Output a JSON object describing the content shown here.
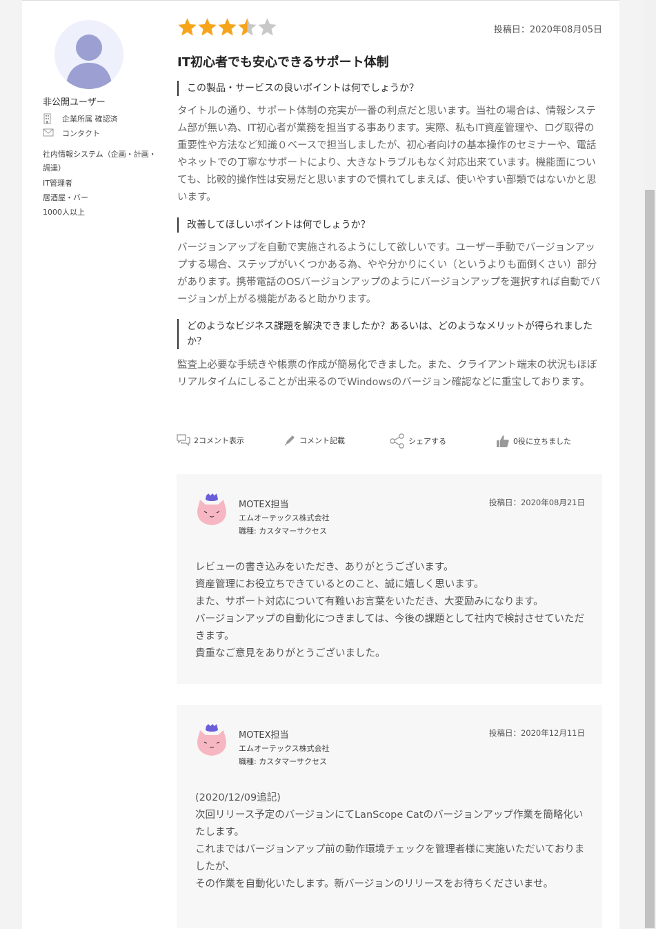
{
  "review": {
    "rating": 3.5,
    "rating_max": 5,
    "date": "投稿日：2020年08月05日",
    "title": "IT初心者でも安心できるサポート体制"
  },
  "user": {
    "name": "非公開ユーザー",
    "company_verified": "企業所属 確認済",
    "contact": "コンタクト",
    "department": "社内情報システム（企画・計画・調達）",
    "position": "IT管理者",
    "industry": "居酒屋・バー",
    "company_size": "1000人以上"
  },
  "questions": [
    {
      "heading": "この製品・サービスの良いポイントは何でしょうか？",
      "answer": "タイトルの通り、サポート体制の充実が一番の利点だと思います。当社の場合は、情報システム部が無い為、IT初心者が業務を担当する事あります。実際、私もIT資産管理や、ログ取得の重要性や方法など知識０ベースで担当しましたが、初心者向けの基本操作のセミナーや、電話やネットでの丁寧なサポートにより、大きなトラブルもなく対応出来ています。機能面についても、比較的操作性は安易だと思いますので慣れてしまえば、使いやすい部類ではないかと思います。"
    },
    {
      "heading": "改善してほしいポイントは何でしょうか？",
      "answer": "バージョンアップを自動で実施されるようにして欲しいです。ユーザー手動でバージョンアップする場合、ステップがいくつかある為、やや分かりにくい（というよりも面倒くさい）部分があります。携帯電話のOSバージョンアップのようにバージョンアップを選択すれば自動でバージョンが上がる機能があると助かります。"
    },
    {
      "heading": "どのようなビジネス課題を解決できましたか？あるいは、どのようなメリットが得られましたか？",
      "answer": "監査上必要な手続きや帳票の作成が簡易化できました。また、クライアント端末の状況もほぼリアルタイムにしることが出来るのでWindowsのバージョン確認などに重宝しております。"
    }
  ],
  "actions": {
    "comments": "2コメント表示",
    "write_comment": "コメント記載",
    "share": "シェアする",
    "helpful": "0役に立ちました"
  },
  "replies": [
    {
      "name": "MOTEX担当",
      "company": "エムオーテックス株式会社",
      "role": "職種: カスタマーサクセス",
      "date": "投稿日：2020年08月21日",
      "text": "レビューの書き込みをいただき、ありがとうございます。\n資産管理にお役立ちできているとのこと、誠に嬉しく思います。\nまた、サポート対応について有難いお言葉をいただき、大変励みになります。\nバージョンアップの自動化につきましては、今後の課題として社内で検討させていただきます。\n貴重なご意見をありがとうございました。"
    },
    {
      "name": "MOTEX担当",
      "company": "エムオーテックス株式会社",
      "role": "職種: カスタマーサクセス",
      "date": "投稿日：2020年12月11日",
      "text": "(2020/12/09追記)\n次回リリース予定のバージョンにてLanScope Catのバージョンアップ作業を簡略化いたします。\nこれまではバージョンアップ前の動作環境チェックを管理者様に実施いただいておりましたが、\nその作業を自動化いたします。新バージョンのリリースをお待ちくださいませ。"
    }
  ],
  "colors": {
    "star_filled": "#f6a41a",
    "star_empty": "#c8c8c8",
    "avatar_bg": "#eef0fb",
    "avatar_figure": "#9b9fd1",
    "reply_bg": "#f7f7f7",
    "mascot_pink": "#f7b7c2",
    "mascot_purple": "#6b5fd9"
  }
}
